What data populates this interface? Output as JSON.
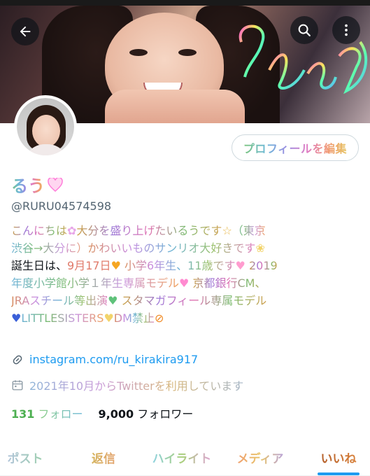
{
  "header": {
    "back_icon": "arrow-left-icon",
    "search_icon": "search-icon",
    "more_icon": "more-vertical-icon"
  },
  "profile": {
    "edit_button_label": "プロフィールを編集",
    "display_name": "るう",
    "handle": "@RURU04574598"
  },
  "bio": {
    "line1_a": "こんにちは",
    "line1_b": "大分を盛り上げたいるうです",
    "line1_c": "（東京",
    "line2_a": "渋谷→大分に）",
    "line2_b": "かわいいものサンリオ大好きです",
    "line3_a": "誕生日は、",
    "line3_b": "9月17日",
    "line3_c": "小学6年生、11歳です",
    "line3_d": "2019",
    "line4_a": "年度小学館小学１年生専属モデル",
    "line4_b": "京都銀行CM、",
    "line5_a": "JRAスチール等出演",
    "line5_b": "スタマガフィール専属モデル",
    "line6_a": "LITTLESISTERS",
    "line6_b": "DM禁止"
  },
  "meta": {
    "link_text": "instagram.com/ru_kirakira917",
    "joined_text": "2021年10月からTwitterを利用しています"
  },
  "stats": {
    "following_count": "131",
    "following_label": "フォロー",
    "followers_count": "9,000",
    "followers_label": "フォロワー"
  },
  "tabs": [
    {
      "label": "ポスト"
    },
    {
      "label": "返信"
    },
    {
      "label": "ハイライト"
    },
    {
      "label": "メディア"
    },
    {
      "label": "いいね",
      "active": true
    }
  ],
  "colors": {
    "link": "#1d9bf0",
    "secondary_text": "#536471",
    "active_tab_indicator": "#1d9bf0"
  }
}
